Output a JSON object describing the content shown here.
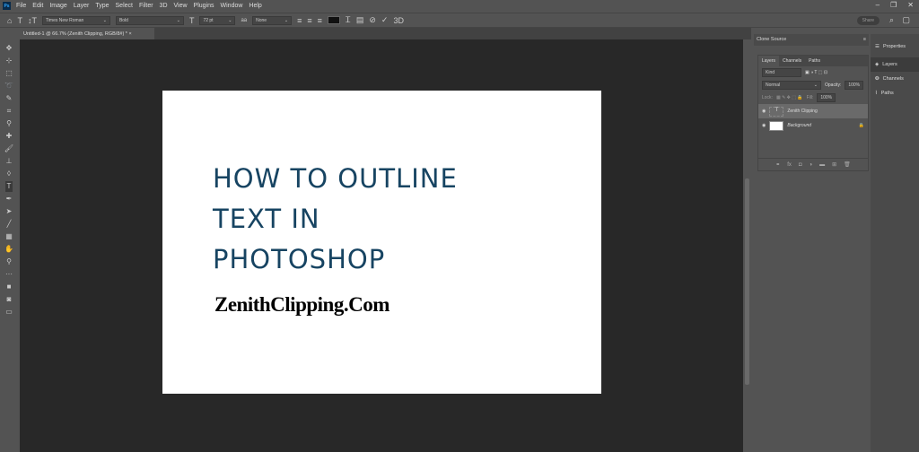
{
  "app": {
    "logo": "Ps"
  },
  "menu": [
    "File",
    "Edit",
    "Image",
    "Layer",
    "Type",
    "Select",
    "Filter",
    "3D",
    "View",
    "Plugins",
    "Window",
    "Help"
  ],
  "options": {
    "font_family": "Times New Roman",
    "font_style": "Bold",
    "font_size": "72 pt",
    "antialias": "None",
    "share": "Share",
    "color": "#111111"
  },
  "document_tab": {
    "title": "Untitled-1 @ 66.7% (Zenith Clipping, RGB/8#) *",
    "close": "×"
  },
  "canvas": {
    "headline": [
      "HOW TO OUTLINE",
      "TEXT IN",
      "PHOTOSHOP"
    ],
    "brand": "ZenithClipping.Com",
    "headline_color": "#174462"
  },
  "clone_source": {
    "title": "Clone Source"
  },
  "layers_panel": {
    "tabs": [
      "Layers",
      "Channels",
      "Paths"
    ],
    "kind": "Kind",
    "blend_mode": "Normal",
    "opacity_label": "Opacity:",
    "opacity": "100%",
    "lock_label": "Lock:",
    "fill_label": "Fill:",
    "fill": "100%",
    "layers": [
      {
        "name": "Zenith Clipping",
        "thumb": "T",
        "selected": true
      },
      {
        "name": "Background",
        "thumb": "",
        "selected": false
      }
    ]
  },
  "right_panel": [
    "Properties",
    "Layers",
    "Channels",
    "Paths"
  ]
}
